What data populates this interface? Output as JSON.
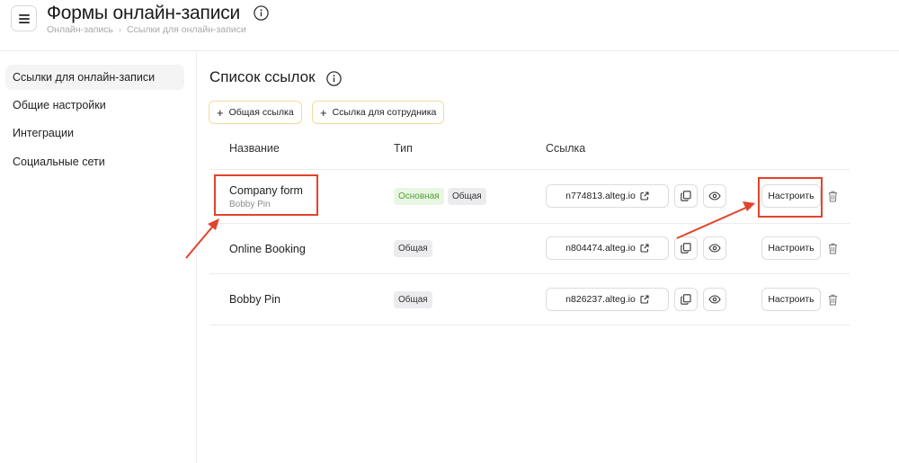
{
  "header": {
    "title": "Формы онлайн-записи",
    "breadcrumb": [
      "Онлайн-запись",
      "Ссылки для онлайн-записи"
    ]
  },
  "sidebar": {
    "items": [
      {
        "label": "Ссылки для онлайн-записи",
        "active": true
      },
      {
        "label": "Общие настройки",
        "active": false
      },
      {
        "label": "Интеграции",
        "active": false
      },
      {
        "label": "Социальные сети",
        "active": false
      }
    ]
  },
  "main": {
    "title": "Список ссылок",
    "add_common_label": "Общая ссылка",
    "add_employee_label": "Ссылка для сотрудника",
    "columns": [
      "Название",
      "Тип",
      "Ссылка"
    ],
    "rows": [
      {
        "name": "Company form",
        "subtitle": "Bobby Pin",
        "tags": [
          "Основная",
          "Общая"
        ],
        "link": "n774813.alteg.io",
        "configure_label": "Настроить"
      },
      {
        "name": "Online Booking",
        "subtitle": "",
        "tags": [
          "Общая"
        ],
        "link": "n804474.alteg.io",
        "configure_label": "Настроить"
      },
      {
        "name": "Bobby Pin",
        "subtitle": "",
        "tags": [
          "Общая"
        ],
        "link": "n826237.alteg.io",
        "configure_label": "Настроить"
      }
    ]
  },
  "colors": {
    "accent_border": "#f2dc9a",
    "tag_primary_bg": "#e9f6e4",
    "tag_primary_text": "#4f9f33",
    "annotation": "#e2432b"
  },
  "icons": {
    "menu": "hamburger-icon",
    "info": "info-icon",
    "plus": "plus-icon",
    "external": "external-link-icon",
    "copy": "copy-icon",
    "preview": "eye-icon",
    "delete": "trash-icon",
    "breadcrumb_separator": "chevron-right-icon"
  }
}
